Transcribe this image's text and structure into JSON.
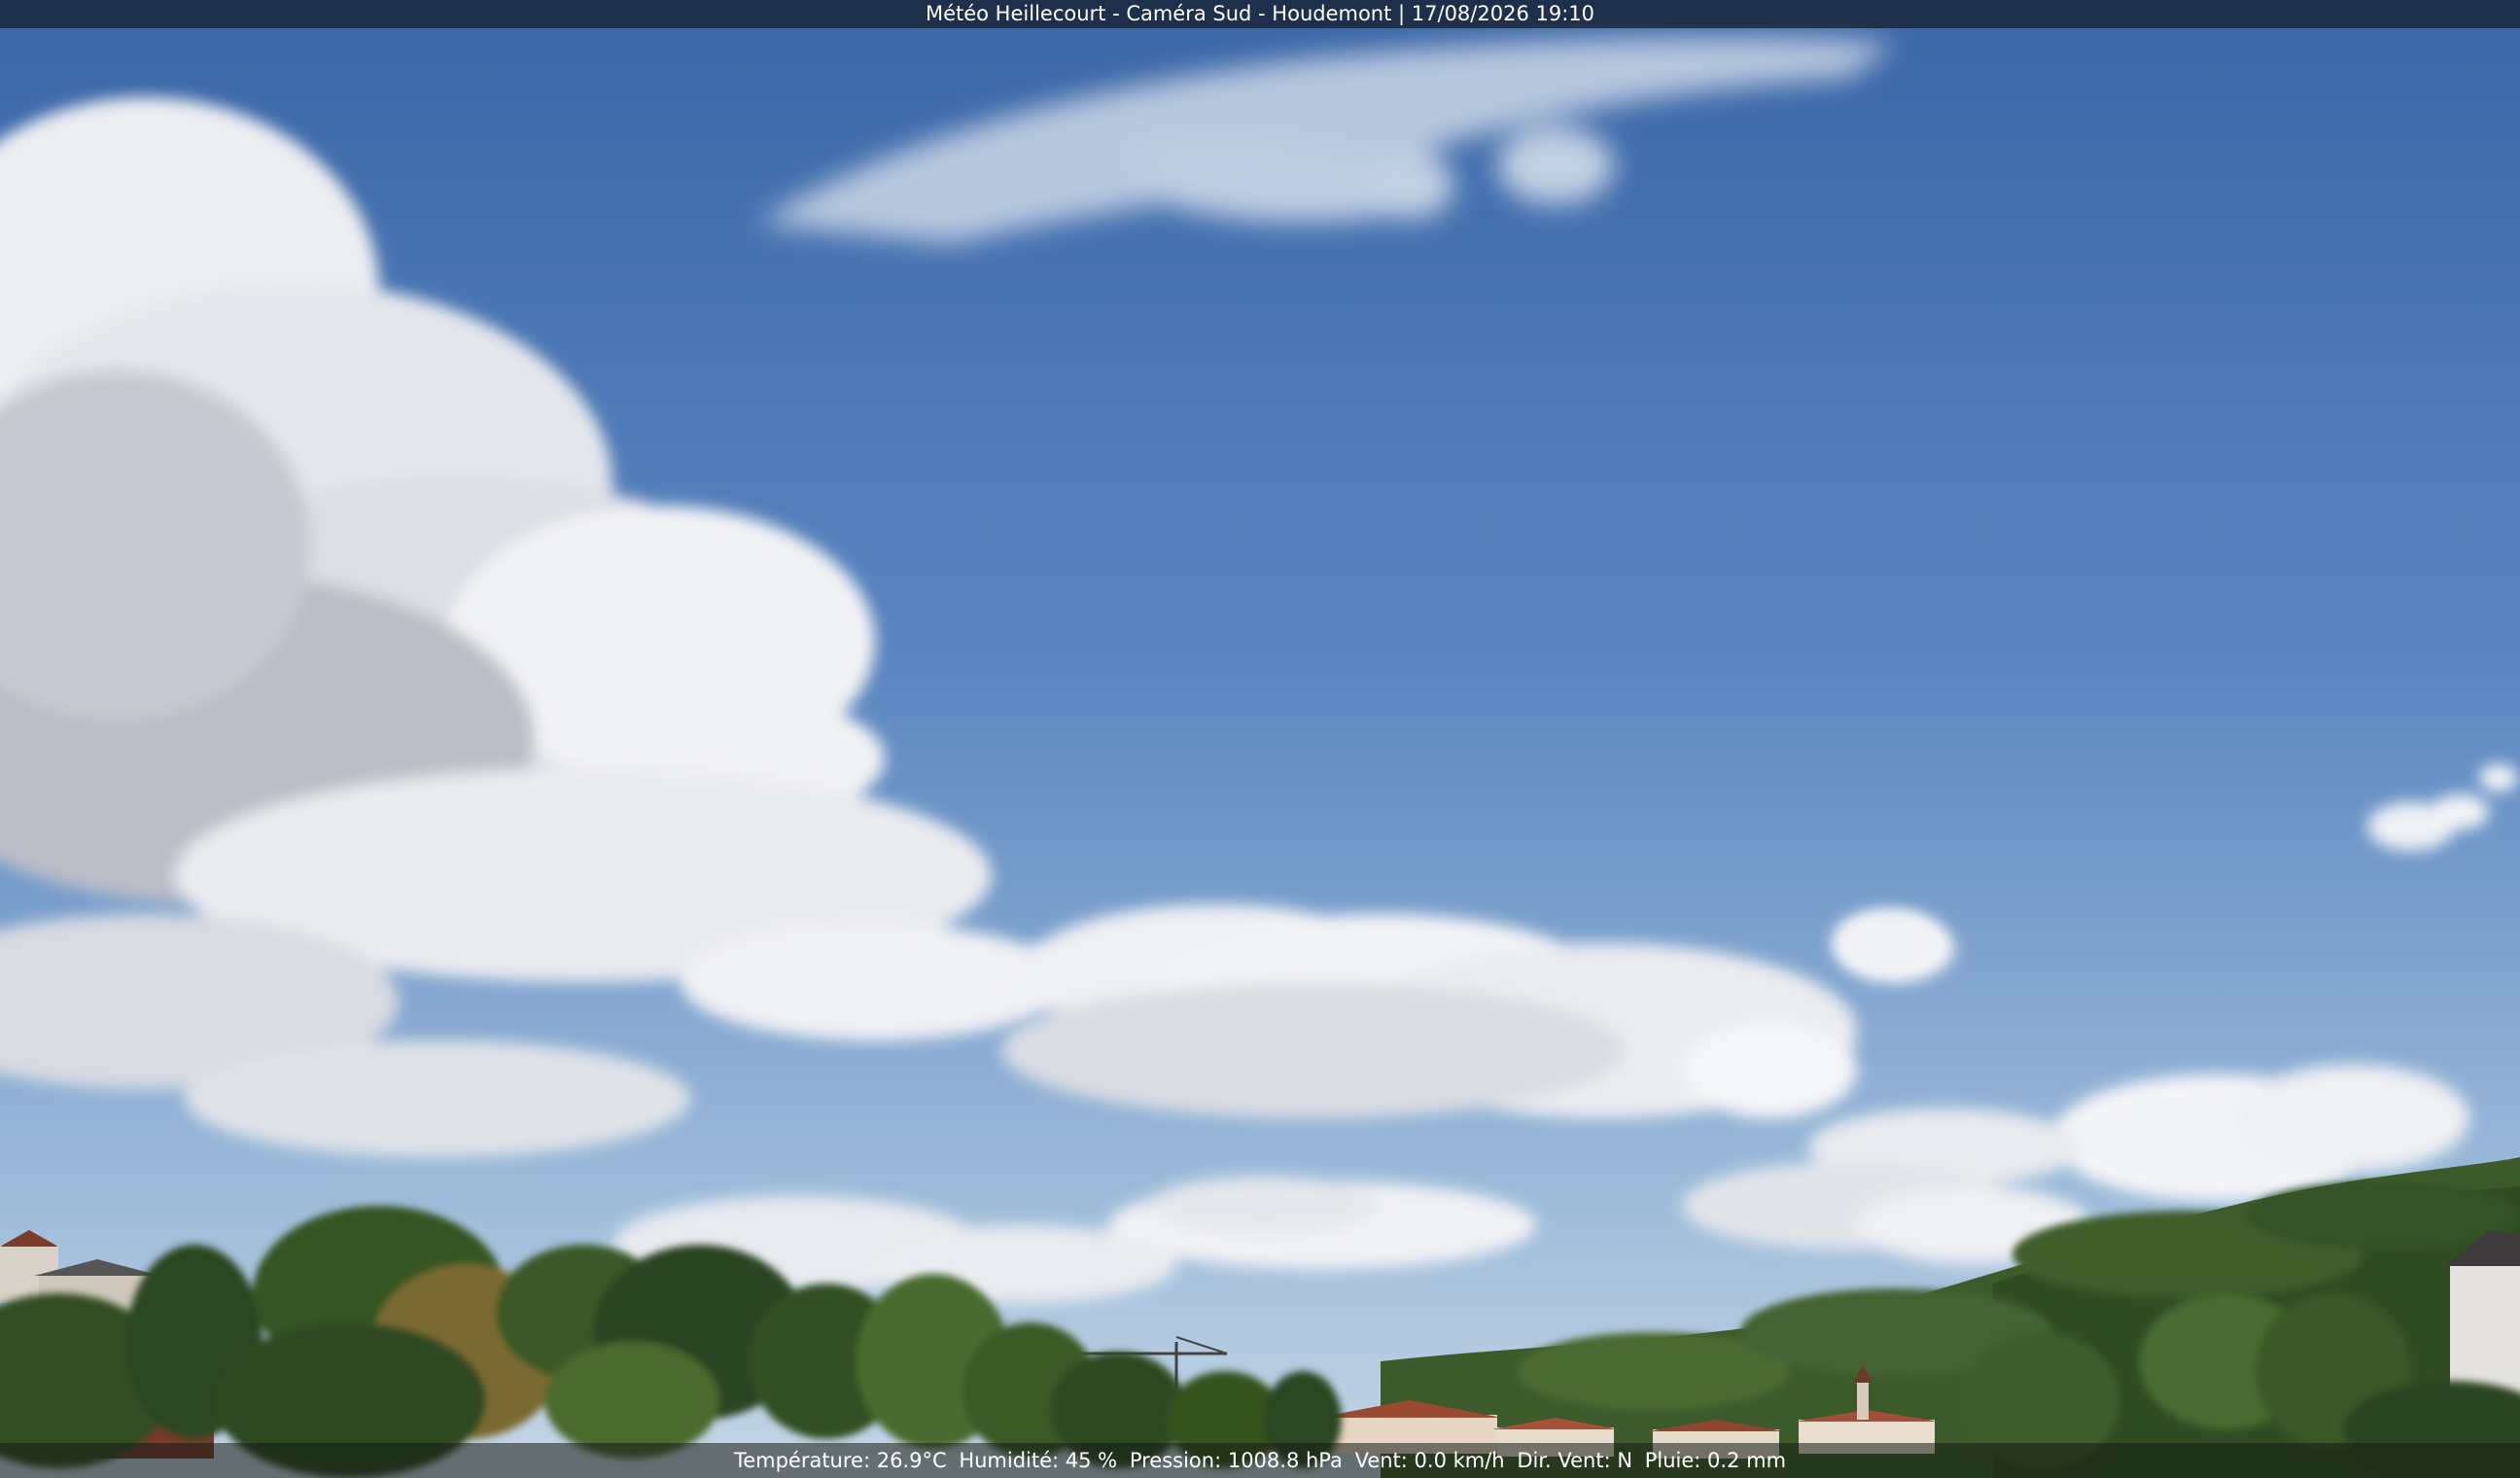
{
  "window": {
    "title": "Météo Heillecourt - Caméra Sud - Houdemont | 17/08/2026 19:10"
  },
  "overlay": {
    "temperature": "Température: 26.9°C",
    "humidity": "Humidité: 45 %",
    "pressure": "Pression: 1008.8 hPa",
    "wind": "Vent: 0.0 km/h",
    "wind_dir": "Dir. Vent: N",
    "rain": "Pluie: 0.2 mm"
  },
  "scene": {
    "subject": "webcam-sky-view",
    "sky_color_top": "#3f6fae",
    "sky_color_horizon": "#b9cfe6",
    "cloud_color": "#f2f3f5",
    "tree_color": "#2f4f1e",
    "hill_color": "#3e5d2b",
    "roof_color": "#9b4a32"
  }
}
